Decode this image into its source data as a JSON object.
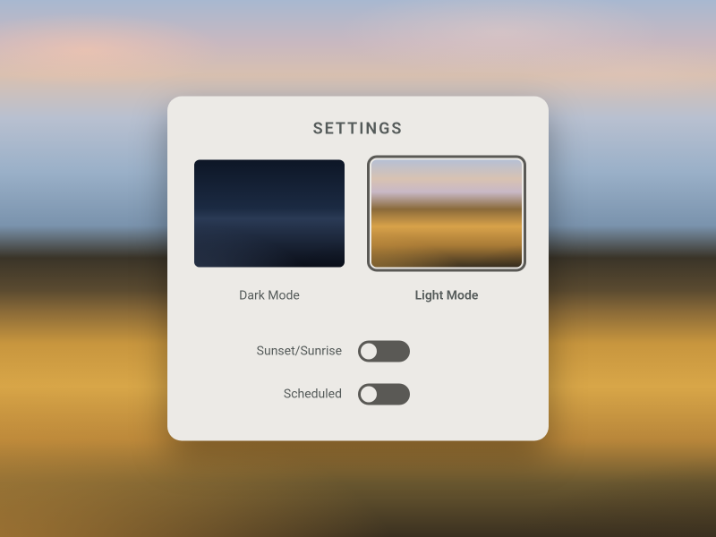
{
  "panel": {
    "title": "SETTINGS",
    "themes": {
      "dark": {
        "label": "Dark Mode",
        "selected": false
      },
      "light": {
        "label": "Light Mode",
        "selected": true
      }
    },
    "toggles": {
      "sunset": {
        "label": "Sunset/Sunrise",
        "on": false
      },
      "scheduled": {
        "label": "Scheduled",
        "on": false
      }
    }
  }
}
